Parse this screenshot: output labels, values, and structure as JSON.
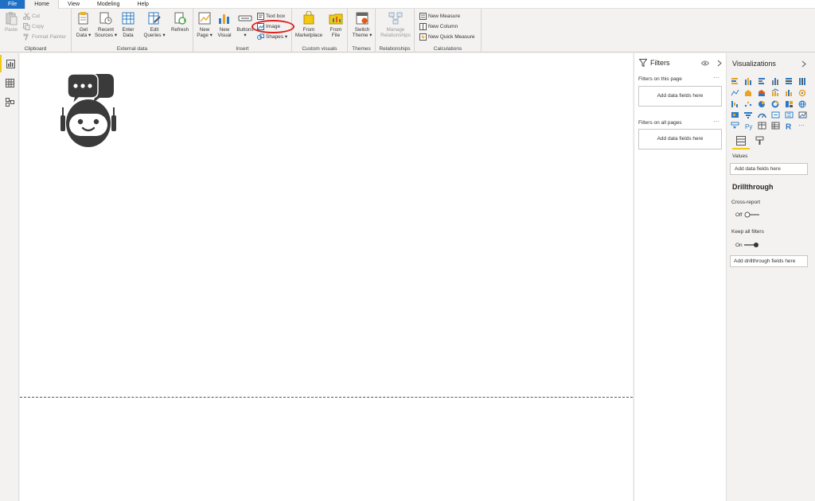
{
  "menu": {
    "file": "File",
    "home": "Home",
    "view": "View",
    "modeling": "Modeling",
    "help": "Help"
  },
  "ribbon": {
    "clipboard": {
      "label": "Clipboard",
      "paste": "Paste",
      "cut": "Cut",
      "copy": "Copy",
      "format_painter": "Format Painter"
    },
    "external_data": {
      "label": "External data",
      "get_data": [
        "Get",
        "Data ▾"
      ],
      "recent_sources": [
        "Recent",
        "Sources ▾"
      ],
      "enter_data": [
        "Enter",
        "Data"
      ],
      "edit_queries": [
        "Edit",
        "Queries ▾"
      ],
      "refresh": "Refresh"
    },
    "insert": {
      "label": "Insert",
      "new_page": [
        "New",
        "Page ▾"
      ],
      "new_visual": [
        "New",
        "Visual"
      ],
      "buttons": [
        "Buttons",
        "▾"
      ],
      "text_box": "Text box",
      "image": "Image",
      "shapes": "Shapes ▾"
    },
    "custom_visuals": {
      "label": "Custom visuals",
      "from_marketplace": [
        "From",
        "Marketplace"
      ],
      "from_file": [
        "From",
        "File"
      ]
    },
    "themes": {
      "label": "Themes",
      "switch_theme": [
        "Switch",
        "Theme ▾"
      ]
    },
    "relationships": {
      "label": "Relationships",
      "manage": [
        "Manage",
        "Relationships"
      ]
    },
    "calculations": {
      "label": "Calculations",
      "new_measure": "New Measure",
      "new_column": "New Column",
      "new_quick_measure": "New Quick Measure"
    }
  },
  "filters": {
    "title": "Filters",
    "on_this_page": "Filters on this page",
    "on_all_pages": "Filters on all pages",
    "add_fields": "Add data fields here",
    "dots": "···"
  },
  "visualizations": {
    "title": "Visualizations",
    "values_label": "Values",
    "values_placeholder": "Add data fields here",
    "drillthrough": "Drillthrough",
    "cross_report": "Cross-report",
    "cross_report_state": "Off",
    "keep_all_filters": "Keep all filters",
    "keep_all_filters_state": "On",
    "drillthrough_placeholder": "Add drillthrough fields here",
    "py": "Py",
    "r": "R",
    "more": "···"
  },
  "colors": {
    "accent": "#f2c811",
    "file_tab": "#1f6fc5",
    "annotation": "#e02020"
  }
}
